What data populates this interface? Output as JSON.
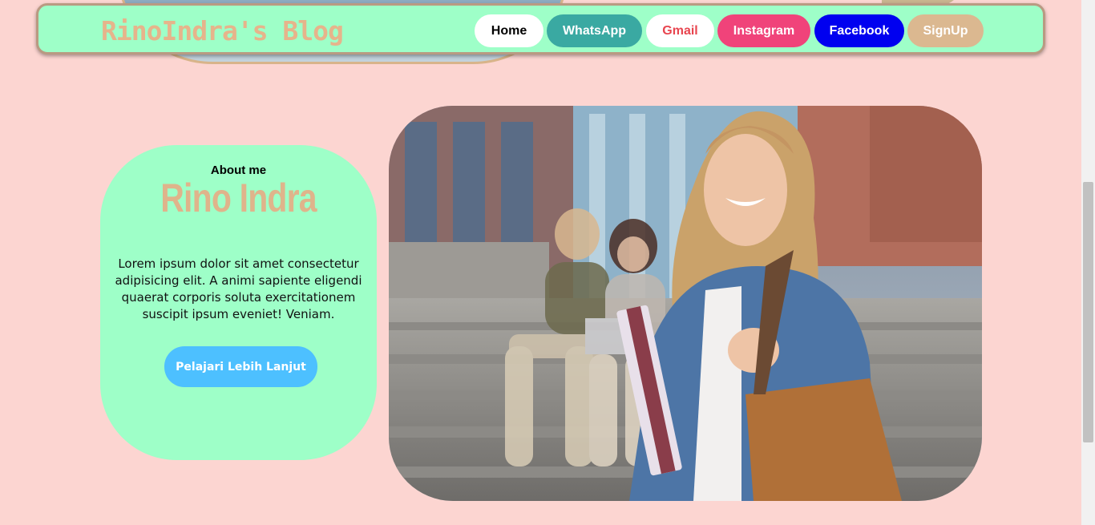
{
  "navbar": {
    "brand": "RinoIndra's Blog",
    "links": [
      {
        "label": "Home",
        "color": "#ffffff"
      },
      {
        "label": "WhatsApp",
        "color": "#3aa9a2"
      },
      {
        "label": "Gmail",
        "color": "#ffffff"
      },
      {
        "label": "Instagram",
        "color": "#f0437a"
      },
      {
        "label": "Facebook",
        "color": "#0000f0"
      },
      {
        "label": "SignUp",
        "color": "#dbb890"
      }
    ]
  },
  "about": {
    "label": "About me",
    "name": "Rino Indra",
    "text": "Lorem ipsum dolor sit amet consectetur adipisicing elit. A animi sapiente eligendi quaerat corporis soluta exercitationem suscipit ipsum eveniet! Veniam.",
    "button_label": "Pelajari Lebih Lanjut"
  },
  "colors": {
    "background": "#fcd5d1",
    "accent_green": "#9effc8",
    "accent_tan": "#dfb48b",
    "button_blue": "#4dc0ff"
  }
}
